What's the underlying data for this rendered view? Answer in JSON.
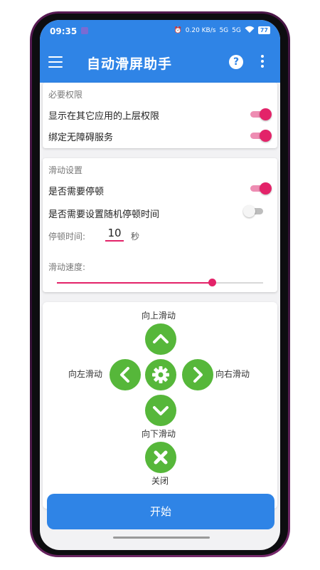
{
  "status_bar": {
    "time": "09:35",
    "net_speed": "0.20 KB/s",
    "sim1": "5G",
    "sim2": "5G",
    "battery": "77"
  },
  "app_bar": {
    "title": "自动滑屏助手",
    "help_icon": "help-circle-icon",
    "menu_icon": "hamburger-menu-icon",
    "more_icon": "more-vert-icon"
  },
  "permissions": {
    "title": "必要权限",
    "overlay_label": "显示在其它应用的上层权限",
    "overlay_on": true,
    "accessibility_label": "绑定无障碍服务",
    "accessibility_on": true
  },
  "scroll_settings": {
    "title": "滑动设置",
    "pause_label": "是否需要停顿",
    "pause_on": true,
    "random_pause_label": "是否需要设置随机停顿时间",
    "random_pause_on": false,
    "pause_time_label": "停顿时间:",
    "pause_time_value": "10",
    "pause_time_unit": "秒",
    "speed_label": "滑动速度:",
    "speed_fraction": 0.75
  },
  "controls": {
    "up": "向上滑动",
    "down": "向下滑动",
    "left": "向左滑动",
    "right": "向右滑动",
    "close": "关闭"
  },
  "start_button": "开始",
  "colors": {
    "primary": "#2f84e6",
    "accent": "#e32369",
    "control_green": "#56b73a"
  }
}
